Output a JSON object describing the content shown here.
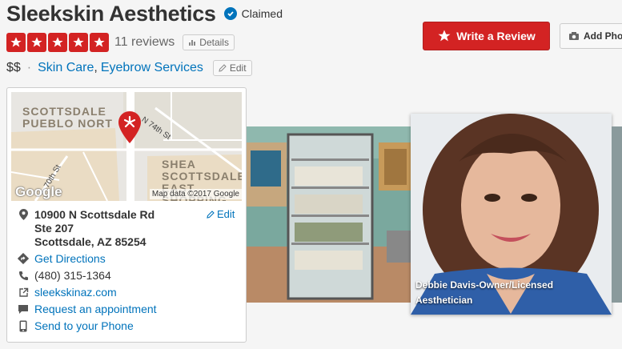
{
  "business": {
    "name": "Sleekskin Aesthetics",
    "claimed_label": "Claimed",
    "rating_stars": 5,
    "review_count": "11 reviews",
    "details_label": "Details",
    "price": "$$",
    "categories": [
      "Skin Care",
      "Eyebrow Services"
    ],
    "edit_label": "Edit"
  },
  "actions": {
    "write_review": "Write a Review",
    "add_photo": "Add Pho"
  },
  "map": {
    "labels": {
      "area1_line1": "SCOTTSDALE",
      "area1_line2": "PUEBLO NORT",
      "area2_line1": "SHEA",
      "area2_line2": "SCOTTSDALE",
      "area2_line3": "EAST SHOPPING",
      "street1": "N 74th St",
      "street2": "70th St"
    },
    "google": "Google",
    "attribution": "Map data ©2017 Google"
  },
  "contact": {
    "address_line1": "10900 N Scottsdale Rd",
    "address_line2": "Ste 207",
    "address_line3": "Scottsdale, AZ 85254",
    "edit_label": "Edit",
    "directions": "Get Directions",
    "phone": "(480) 315-1364",
    "website": "sleekskinaz.com",
    "appointment": "Request an appointment",
    "send_phone": "Send to your Phone"
  },
  "photos": {
    "caption_line1": "Debbie Davis-Owner/Licensed",
    "caption_line2": "Aesthetician"
  },
  "colors": {
    "brand_red": "#d32323",
    "link_blue": "#0073bb"
  }
}
